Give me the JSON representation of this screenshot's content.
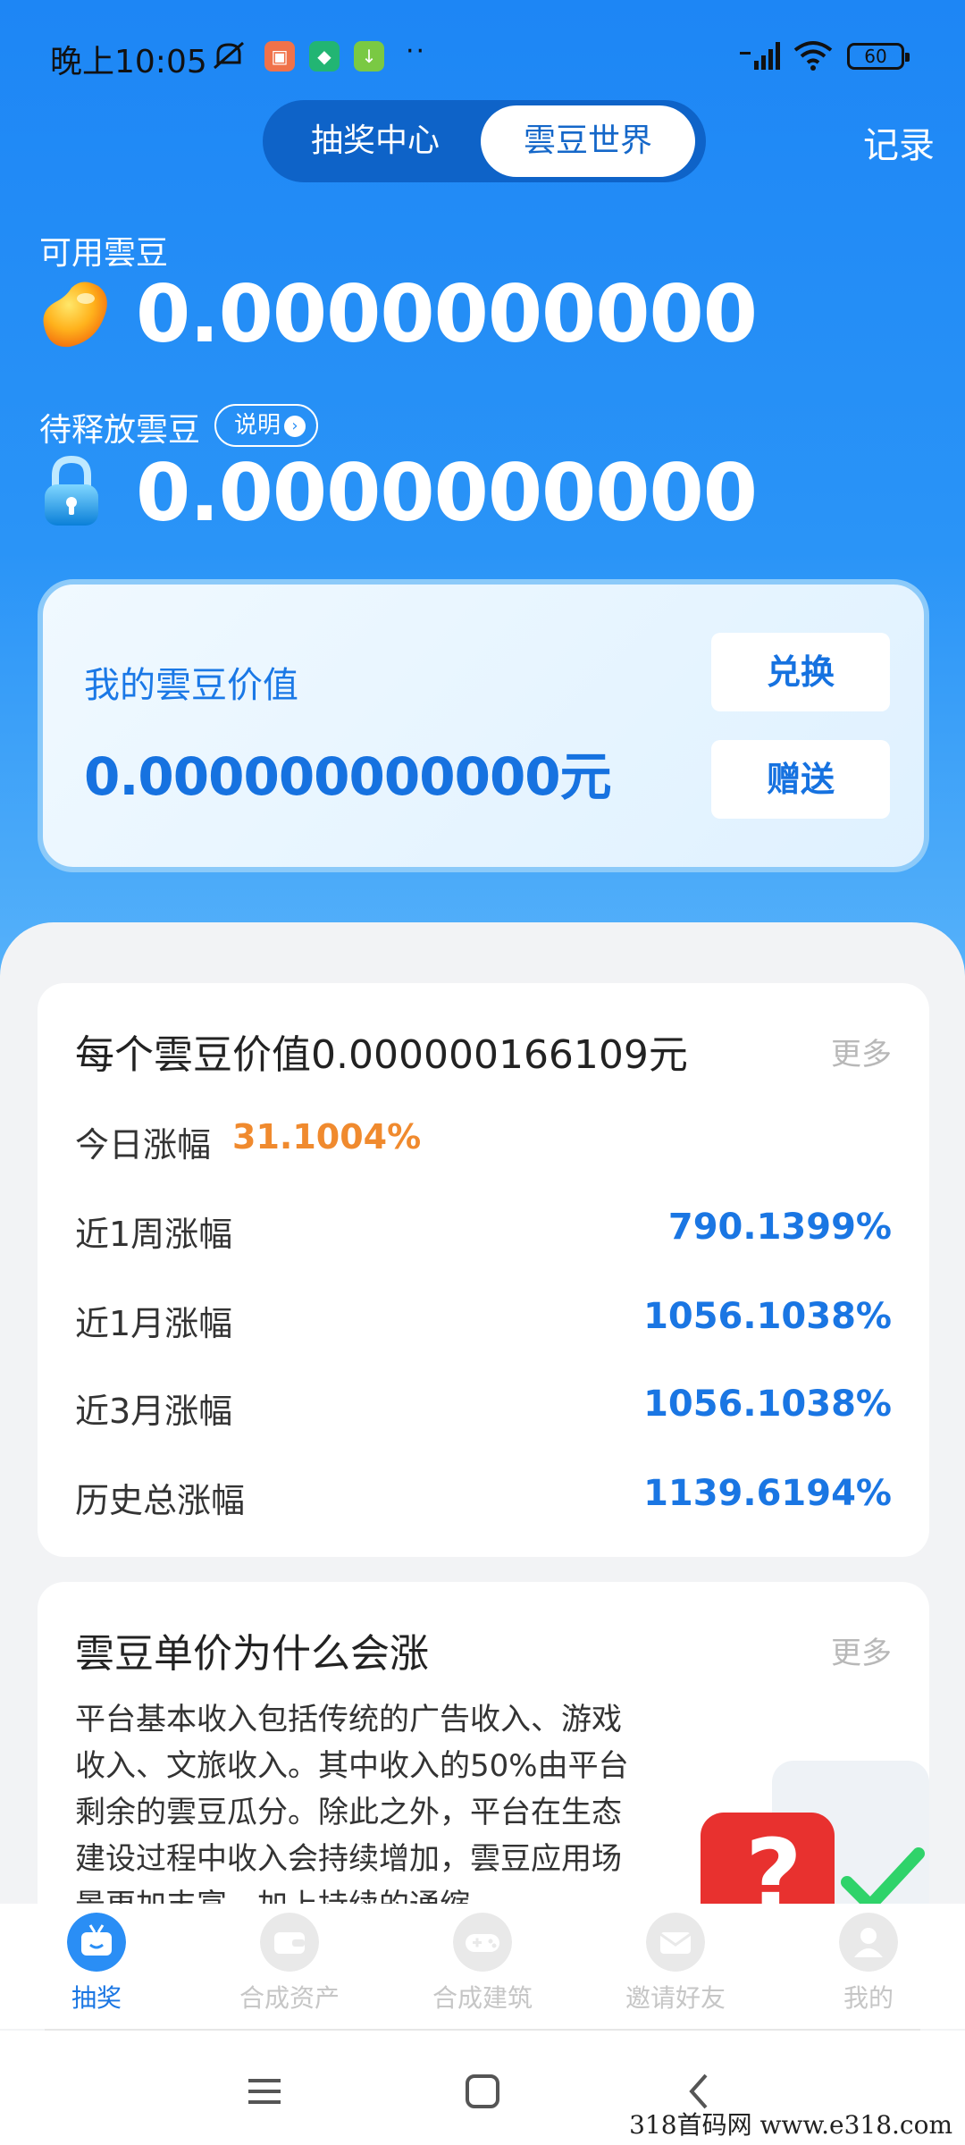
{
  "status_bar": {
    "time": "晚上10:05",
    "battery": "60",
    "dots": "··"
  },
  "tabs": {
    "left": "抽奖中心",
    "right": "雲豆世界",
    "record": "记录"
  },
  "available": {
    "label": "可用雲豆",
    "value": "0.0000000000"
  },
  "pending": {
    "label": "待释放雲豆",
    "explain": "说明",
    "value": "0.0000000000"
  },
  "value_card": {
    "title": "我的雲豆价值",
    "value": "0.000000000000元",
    "exchange": "兑换",
    "gift": "赠送"
  },
  "stats_card": {
    "title": "每个雲豆价值0.000000166109元",
    "more": "更多",
    "today_label": "今日涨幅",
    "today_value": "31.1004%",
    "rows": [
      {
        "label": "近1周涨幅",
        "value": "790.1399%"
      },
      {
        "label": "近1月涨幅",
        "value": "1056.1038%"
      },
      {
        "label": "近3月涨幅",
        "value": "1056.1038%"
      },
      {
        "label": "历史总涨幅",
        "value": "1139.6194%"
      }
    ]
  },
  "info_card": {
    "title": "雲豆单价为什么会涨",
    "more": "更多",
    "body": "平台基本收入包括传统的广告收入、游戏收入、文旅收入。其中收入的50%由平台剩余的雲豆瓜分。除此之外，平台在生态建设过程中收入会持续增加，雲豆应用场景更加丰富，加上持续的通缩"
  },
  "tabbar": [
    {
      "label": "抽奖",
      "icon": "gift-tv-icon"
    },
    {
      "label": "合成资产",
      "icon": "wallet-icon"
    },
    {
      "label": "合成建筑",
      "icon": "gamepad-icon"
    },
    {
      "label": "邀请好友",
      "icon": "envelope-icon"
    },
    {
      "label": "我的",
      "icon": "user-icon"
    }
  ],
  "watermark": "318首码网  www.e318.com",
  "colors": {
    "brand": "#1d86f5",
    "accent_orange": "#f08a2e",
    "value_blue": "#1a76e3"
  }
}
